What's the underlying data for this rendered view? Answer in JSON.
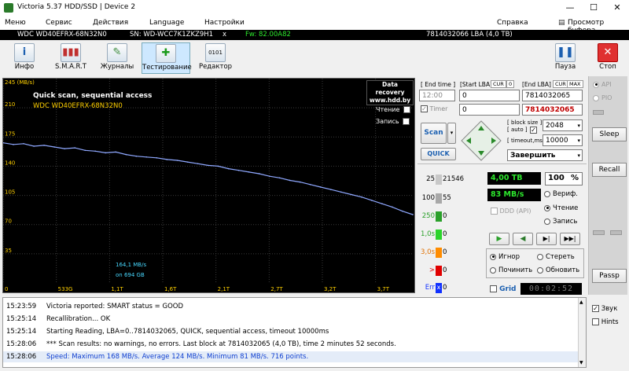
{
  "window": {
    "title": "Victoria 5.37 HDD/SSD | Device 2",
    "minimize": "—",
    "maximize": "☐",
    "close": "✕"
  },
  "menu": {
    "items": [
      "Меню",
      "Сервис",
      "Действия",
      "Language",
      "Настройки"
    ],
    "help": "Справка",
    "clipboard": "Просмотр буфера"
  },
  "drive": {
    "model": "WDC WD40EFRX-68N32N0",
    "serial": "SN: WD-WCC7K1ZKZ9H1",
    "x": "x",
    "firmware": "Fw: 82.00A82",
    "lba": "7814032066 LBA (4,0 TB)"
  },
  "toolbar": {
    "items": [
      {
        "label": "Инфо",
        "icon": "info-icon"
      },
      {
        "label": "S.M.A.R.T",
        "icon": "smart-chart-icon"
      },
      {
        "label": "Журналы",
        "icon": "journal-icon"
      },
      {
        "label": "Тестирование",
        "icon": "test-plus-icon"
      },
      {
        "label": "Редактор",
        "icon": "hex-editor-icon"
      }
    ],
    "pause": "Пауза",
    "stop": "Стоп"
  },
  "graph": {
    "unit": "245 (MB/s)",
    "watermark1": "Data recovery",
    "watermark2": "www.hdd.by",
    "title1": "Quick scan, sequential access",
    "title2": "WDC WD40EFRX-68N32N0",
    "read_label": "Чтение",
    "write_label": "Запись",
    "speed_readout": "164,1 MB/s",
    "pos_readout": "on 694 GB"
  },
  "chart_data": {
    "type": "line",
    "ylabel": "245 (MB/s)",
    "y_ticks": [
      "210",
      "175",
      "140",
      "105",
      "70",
      "35"
    ],
    "x_ticks": [
      "0",
      "533G",
      "1,1T",
      "1,6T",
      "2,1T",
      "2,7T",
      "3,2T",
      "3,7T"
    ],
    "ylim": [
      0,
      245
    ],
    "x_tb": [
      0,
      0.1,
      0.2,
      0.3,
      0.4,
      0.5,
      0.6,
      0.7,
      0.8,
      0.9,
      1.0,
      1.1,
      1.2,
      1.3,
      1.4,
      1.5,
      1.6,
      1.7,
      1.8,
      1.9,
      2.0,
      2.1,
      2.2,
      2.3,
      2.4,
      2.5,
      2.6,
      2.7,
      2.8,
      2.9,
      3.0,
      3.1,
      3.2,
      3.3,
      3.4,
      3.5,
      3.6,
      3.7,
      3.8,
      3.9,
      4.0
    ],
    "y": [
      168,
      166,
      167,
      164,
      165,
      163,
      161,
      162,
      159,
      158,
      156,
      157,
      154,
      152,
      151,
      150,
      148,
      147,
      145,
      143,
      141,
      140,
      137,
      135,
      133,
      131,
      128,
      126,
      123,
      121,
      118,
      115,
      112,
      109,
      106,
      103,
      99,
      95,
      91,
      86,
      82
    ]
  },
  "controls": {
    "end_time_label": "[ End time ]",
    "start_lba_label": "[Start LBA]",
    "cur1": "CUR",
    "zero1": "0",
    "end_lba_label": "[End LBA]",
    "cur2": "CUR",
    "max2": "MAX",
    "end_time": "12:00",
    "start_lba": "0",
    "end_lba": "7814032065",
    "timer_label": "Timer",
    "timer_value": "0",
    "cur_lba": "7814032065",
    "scan": "Scan",
    "quick": "QUICK",
    "block_size_label": "[ block size ]",
    "auto_label": "[ auto ]",
    "timeout_label": "[ timeout,ms ]",
    "block_size": "2048",
    "timeout": "10000",
    "finish": "Завершить",
    "api": "API",
    "pio": "PIO"
  },
  "stats": {
    "counters": [
      {
        "label": "25",
        "value": "21546",
        "color": "#c8c8c8"
      },
      {
        "label": "100",
        "value": "55",
        "color": "#a8a8a8"
      },
      {
        "label": "250",
        "value": "0",
        "color": "#2aa02a"
      },
      {
        "label": "1,0s",
        "value": "0",
        "color": "#2ad42a"
      },
      {
        "label": "3,0s",
        "value": "0",
        "color": "#ff8c00"
      },
      {
        "label": ">",
        "value": "0",
        "color": "#e00000"
      },
      {
        "label": "Err",
        "value": "0",
        "color": "#1030ff"
      }
    ],
    "err_x": "x",
    "size": "4,00 TB",
    "percent": "100",
    "percent_unit": "%",
    "speed": "83 MB/s",
    "verify": "Вериф.",
    "read": "Чтение",
    "write": "Запись",
    "ddd": "DDD (API)",
    "ignore": "Игнор",
    "erase": "Стереть",
    "fix": "Починить",
    "update": "Обновить",
    "grid": "Grid",
    "timer_display": "00:02:52"
  },
  "side": {
    "sleep": "Sleep",
    "recall": "Recall",
    "passp": "Passp",
    "sound": "Звук",
    "hints": "Hints"
  },
  "log": [
    {
      "time": "15:23:59",
      "msg": "Victoria reported: SMART status = GOOD"
    },
    {
      "time": "15:25:14",
      "msg": "Recallibration... OK"
    },
    {
      "time": "15:25:14",
      "msg": "Starting Reading, LBA=0..7814032065, QUICK, sequential access, timeout 10000ms"
    },
    {
      "time": "15:28:06",
      "msg": "*** Scan results: no warnings, no errors. Last block at 7814032065 (4,0 TB), time 2 minutes 52 seconds."
    },
    {
      "time": "15:28:06",
      "msg": "Speed: Maximum 168 MB/s. Average 124 MB/s. Minimum 81 MB/s. 716 points."
    }
  ],
  "colors": {
    "graph_line": "#8fa8ff",
    "axis_text": "#ffd000",
    "speed_text": "#1040d0",
    "drive_model": "#ffffff",
    "drive_lba": "#ffffff",
    "drive_fw": "#2de82d"
  }
}
